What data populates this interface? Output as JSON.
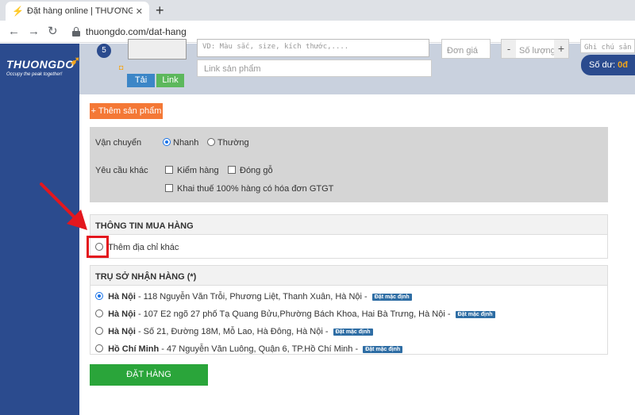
{
  "browser": {
    "tab_title": "Đặt hàng online | THƯƠNG ĐÔ L",
    "tab_close": "✕",
    "new_tab": "+",
    "url": "thuongdo.com/dat-hang"
  },
  "sidebar": {
    "logo_name": "THUONGDO",
    "logo_tagline": "Occupy the peak together!"
  },
  "item_form": {
    "number": "5",
    "upload_label": "Tải",
    "link_label": "Link",
    "description_placeholder": "VD: Màu sắc, size, kích thước,....",
    "link_placeholder": "Link sản phẩm",
    "price_placeholder": "Đơn giá",
    "qty_minus": "-",
    "qty_placeholder": "Số lượng",
    "qty_plus": "+",
    "note_placeholder": "Ghi chú sản",
    "balance_label": "Số dư:",
    "balance_value": "0đ"
  },
  "actions": {
    "add_product": "+ Thêm sản phẩm",
    "place_order": "ĐẶT HÀNG"
  },
  "shipping": {
    "label": "Vận chuyển",
    "fast": "Nhanh",
    "normal": "Thường",
    "selected": "fast"
  },
  "requests": {
    "label": "Yêu cầu khác",
    "inspect": "Kiểm hàng",
    "wood_pack": "Đóng gỗ",
    "vat": "Khai thuế 100% hàng có hóa đơn GTGT"
  },
  "buyer_info": {
    "heading": "THÔNG TIN MUA HÀNG",
    "other_address": "Thêm địa chỉ khác"
  },
  "receiving": {
    "heading": "TRỤ SỞ NHẬN HÀNG (*)",
    "default_tag": "Đặt mặc định",
    "addresses": [
      {
        "city": "Hà Nội",
        "detail": " - 118 Nguyễn Văn Trỗi, Phương Liệt, Thanh Xuân, Hà Nội - ",
        "selected": true
      },
      {
        "city": "Hà Nội",
        "detail": " - 107 E2 ngõ 27 phố Tạ Quang Bửu,Phường Bách Khoa, Hai Bà Trưng, Hà Nội - ",
        "selected": false
      },
      {
        "city": "Hà Nội",
        "detail": " - Số 21, Đường 18M, Mỗ Lao, Hà Đông, Hà Nội - ",
        "selected": false
      },
      {
        "city": "Hồ Chí Minh",
        "detail": " - 47 Nguyễn Văn Luông, Quận 6, TP.Hồ Chí Minh - ",
        "selected": false
      }
    ]
  },
  "colors": {
    "sidebar": "#2b4b8e",
    "orange_button": "#f47836",
    "green_button": "#2aa53a",
    "annotation_red": "#e3171e"
  }
}
